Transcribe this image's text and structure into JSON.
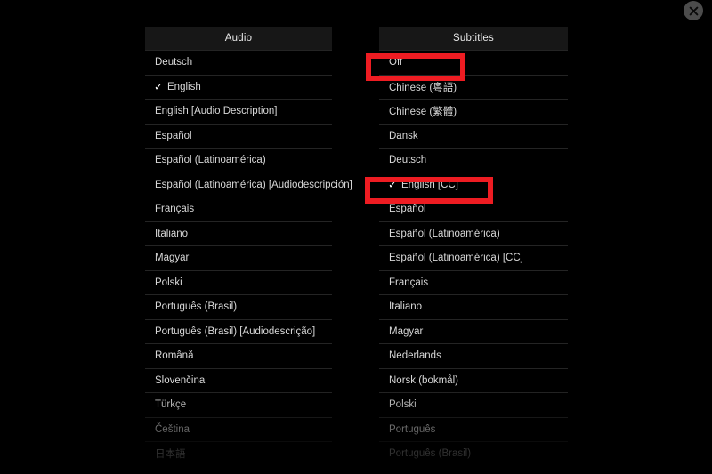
{
  "dialog": {
    "close_icon": "close-circle-icon",
    "close_label": "Close"
  },
  "columns": [
    {
      "id": "audio",
      "header": "Audio",
      "items": [
        {
          "label": "Deutsch",
          "checked": false
        },
        {
          "label": "English",
          "checked": true
        },
        {
          "label": "English [Audio Description]",
          "checked": false
        },
        {
          "label": "Español",
          "checked": false
        },
        {
          "label": "Español (Latinoamérica)",
          "checked": false
        },
        {
          "label": "Español (Latinoamérica) [Audiodescripción]",
          "checked": false
        },
        {
          "label": "Français",
          "checked": false
        },
        {
          "label": "Italiano",
          "checked": false
        },
        {
          "label": "Magyar",
          "checked": false
        },
        {
          "label": "Polski",
          "checked": false
        },
        {
          "label": "Português (Brasil)",
          "checked": false
        },
        {
          "label": "Português (Brasil) [Audiodescrição]",
          "checked": false
        },
        {
          "label": "Română",
          "checked": false
        },
        {
          "label": "Slovenčina",
          "checked": false
        },
        {
          "label": "Türkçe",
          "checked": false
        },
        {
          "label": "Čeština",
          "checked": false
        },
        {
          "label": "日本語",
          "checked": false
        }
      ]
    },
    {
      "id": "subtitles",
      "header": "Subtitles",
      "items": [
        {
          "label": "Off",
          "checked": false
        },
        {
          "label": "Chinese (粵語)",
          "checked": false
        },
        {
          "label": "Chinese (繁體)",
          "checked": false
        },
        {
          "label": "Dansk",
          "checked": false
        },
        {
          "label": "Deutsch",
          "checked": false
        },
        {
          "label": "English [CC]",
          "checked": true
        },
        {
          "label": "Español",
          "checked": false
        },
        {
          "label": "Español (Latinoamérica)",
          "checked": false
        },
        {
          "label": "Español (Latinoamérica) [CC]",
          "checked": false
        },
        {
          "label": "Français",
          "checked": false
        },
        {
          "label": "Italiano",
          "checked": false
        },
        {
          "label": "Magyar",
          "checked": false
        },
        {
          "label": "Nederlands",
          "checked": false
        },
        {
          "label": "Norsk (bokmål)",
          "checked": false
        },
        {
          "label": "Polski",
          "checked": false
        },
        {
          "label": "Português",
          "checked": false
        },
        {
          "label": "Português (Brasil)",
          "checked": false
        }
      ]
    }
  ],
  "annotations": [
    {
      "id": "redbox-off",
      "target": "Off",
      "color": "#ee1c22"
    },
    {
      "id": "redbox-english",
      "target": "English [CC]",
      "color": "#ee1c22"
    }
  ],
  "icons": {
    "check": "✓",
    "close": "×"
  }
}
